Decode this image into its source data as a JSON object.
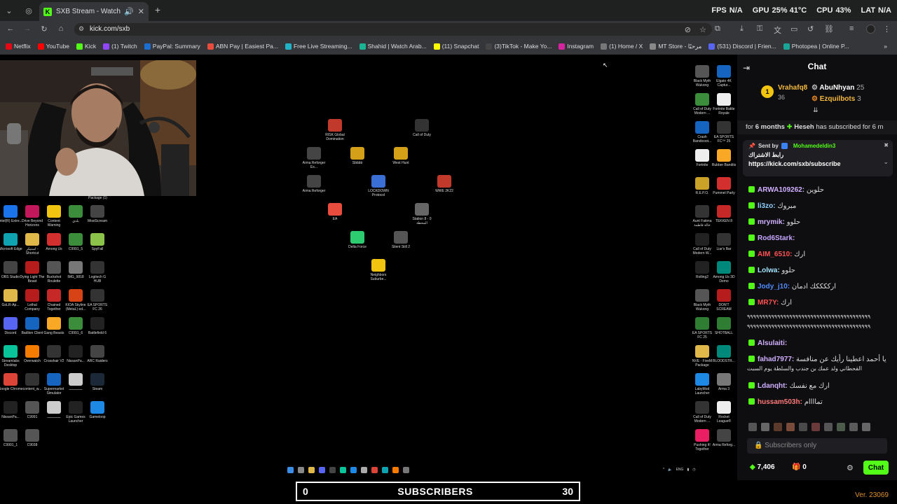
{
  "browser": {
    "tab_title": "SXB Stream - Watch Live on",
    "url": "kick.com/sxb",
    "stats": {
      "fps_label": "FPS",
      "fps_value": "N/A",
      "gpu_label": "GPU",
      "gpu_value": "25% 41°C",
      "cpu_label": "CPU",
      "cpu_value": "43%",
      "lat_label": "LAT",
      "lat_value": "N/A"
    },
    "bookmarks": [
      {
        "label": "Netflix",
        "color": "#e50914"
      },
      {
        "label": "YouTube",
        "color": "#ff0000"
      },
      {
        "label": "Kick",
        "color": "#53fc18"
      },
      {
        "label": "(1) Twitch",
        "color": "#9146ff"
      },
      {
        "label": "PayPal: Summary",
        "color": "#1a6fd1"
      },
      {
        "label": "ABN Pay | Easiest Pa...",
        "color": "#e74c3c"
      },
      {
        "label": "Free Live Streaming...",
        "color": "#21b3c6"
      },
      {
        "label": "Shahid | Watch Arab...",
        "color": "#1ab394"
      },
      {
        "label": "(11) Snapchat",
        "color": "#fffc00"
      },
      {
        "label": "(3)TikTok - Make Yo...",
        "color": "#444444"
      },
      {
        "label": "Instagram",
        "color": "#d6249f"
      },
      {
        "label": "(1) Home / X",
        "color": "#777777"
      },
      {
        "label": "MT Store - مرحبًا",
        "color": "#888888"
      },
      {
        "label": "(531) Discord | Frien...",
        "color": "#5865f2"
      },
      {
        "label": "Photopea | Online P...",
        "color": "#18a497"
      }
    ]
  },
  "desktop": {
    "webcam_caption": "Package (1)",
    "icons": [
      {
        "label": "RISK Global Domination",
        "color": "#c0392b"
      },
      {
        "label": "Call of Duty",
        "color": "#333333"
      },
      {
        "label": "Arma Reforger Ex...",
        "color": "#444444"
      },
      {
        "label": "Sbbbb",
        "color": "#d4a017"
      },
      {
        "label": "West Hunt",
        "color": "#d4a017"
      },
      {
        "label": "Arma Reforger",
        "color": "#444444"
      },
      {
        "label": "LOCKDOWN Protocol",
        "color": "#3a6fd6"
      },
      {
        "label": "WWE 2K22",
        "color": "#c0392b"
      },
      {
        "label": "EA",
        "color": "#e74c3c"
      },
      {
        "label": "Station 8 - 0 المحطة",
        "color": "#666666"
      },
      {
        "label": "Delta Force",
        "color": "#2ecc71"
      },
      {
        "label": "Silent Still 2",
        "color": "#555555"
      },
      {
        "label": "Neighbors Suburbe...",
        "color": "#f1c40f"
      }
    ],
    "left_icons": [
      {
        "label": "Intel(R) Extre...",
        "color": "#1a73e8"
      },
      {
        "label": "Drive Beyond Horizons",
        "color": "#c2185b"
      },
      {
        "label": "Content Warning",
        "color": "#f1c40f"
      },
      {
        "label": "بلدي",
        "color": "#3b8c3b"
      },
      {
        "label": "MostScream",
        "color": "#444444"
      },
      {
        "label": "Microsoft Edge",
        "color": "#0fa3b1"
      },
      {
        "label": "استیکر - Shortcut",
        "color": "#e0b84a"
      },
      {
        "label": "Among Us",
        "color": "#d32f2f"
      },
      {
        "label": "C9991_5",
        "color": "#3b8c3b"
      },
      {
        "label": "SpyFall",
        "color": "#8bc34a"
      },
      {
        "label": "OBS Studio",
        "color": "#444444"
      },
      {
        "label": "Dying Light The Beast",
        "color": "#b71c1c"
      },
      {
        "label": "Buckshot Roulette",
        "color": "#555555"
      },
      {
        "label": "IMG_9818",
        "color": "#777777"
      },
      {
        "label": "Logitech G HUB",
        "color": "#333333"
      },
      {
        "label": "GoLR-Ap...",
        "color": "#e0b84a"
      },
      {
        "label": "Lethal Company",
        "color": "#b71c1c"
      },
      {
        "label": "Chained Together",
        "color": "#c62828"
      },
      {
        "label": "KIOA Skyline (MetaL) ed...",
        "color": "#d84315"
      },
      {
        "label": "EA SPORTS FC 26",
        "color": "#333333"
      },
      {
        "label": "Discord",
        "color": "#5865f2"
      },
      {
        "label": "Badlion Client",
        "color": "#1565c0"
      },
      {
        "label": "Gang Beasts",
        "color": "#f9a825"
      },
      {
        "label": "C9991_6",
        "color": "#3b8c3b"
      },
      {
        "label": "Battlefield 6",
        "color": "#222222"
      },
      {
        "label": "Streamlabs Desktop",
        "color": "#09c39b"
      },
      {
        "label": "Overwatch",
        "color": "#f57c00"
      },
      {
        "label": "Crosshair V2",
        "color": "#333333"
      },
      {
        "label": "NissanPa...",
        "color": "#222222"
      },
      {
        "label": "ARC Raiders",
        "color": "#444444"
      },
      {
        "label": "Google Chrome",
        "color": "#db4437"
      },
      {
        "label": "content_w...",
        "color": "#333333"
      },
      {
        "label": "Supermarket Simulator",
        "color": "#1565c0"
      },
      {
        "label": "ـــــــــــــ",
        "color": "#cccccc"
      },
      {
        "label": "Steam",
        "color": "#1b2838"
      },
      {
        "label": "NissanPa...",
        "color": "#222222"
      },
      {
        "label": "C9991",
        "color": "#555555"
      },
      {
        "label": "ـــــــــــــ",
        "color": "#cccccc"
      },
      {
        "label": "Epic Games Launcher",
        "color": "#222222"
      },
      {
        "label": "Gameloop",
        "color": "#1e88e5"
      },
      {
        "label": "C9991_1",
        "color": "#555555"
      },
      {
        "label": "C9038",
        "color": "#555555"
      }
    ],
    "right_icons": [
      {
        "label": "Black Myth Wukong",
        "color": "#555555"
      },
      {
        "label": "Elgato 4K Captur...",
        "color": "#1565c0"
      },
      {
        "label": "Call of Duty Modern ...",
        "color": "#3b8c3b"
      },
      {
        "label": "Fortnite Battle Royale",
        "color": "#eeeeee"
      },
      {
        "label": "Crash Bandicoot...",
        "color": "#1565c0"
      },
      {
        "label": "EA SPORTS FC™ 25",
        "color": "#333333"
      },
      {
        "label": "Fortnite",
        "color": "#eeeeee"
      },
      {
        "label": "Rubber Bandits",
        "color": "#f9a825"
      },
      {
        "label": "R.E.P.O.",
        "color": "#c9a227"
      },
      {
        "label": "Pummel Party",
        "color": "#d32f2f"
      },
      {
        "label": "Aunt Fatima خالة فاطمة",
        "color": "#333333"
      },
      {
        "label": "TEKKEN 8",
        "color": "#c62828"
      },
      {
        "label": "Call of Duty Modern W...",
        "color": "#222222"
      },
      {
        "label": "Liar's Bar",
        "color": "#333333"
      },
      {
        "label": "Rolling2",
        "color": "#222222"
      },
      {
        "label": "Among Us 3D Demo",
        "color": "#00897b"
      },
      {
        "label": "Black Myth Wukong",
        "color": "#555555"
      },
      {
        "label": "DON'T SCREAM",
        "color": "#b71c1c"
      },
      {
        "label": "EA SPORTS FC 25",
        "color": "#2e7d32"
      },
      {
        "label": "SHOTBALL",
        "color": "#2e7d32"
      },
      {
        "label": "NVE - FiveM Package",
        "color": "#e0b84a"
      },
      {
        "label": "BLOODSTR...",
        "color": "#00897b"
      },
      {
        "label": "LabyMod Launcher",
        "color": "#1e88e5"
      },
      {
        "label": "Arma 3",
        "color": "#777777"
      },
      {
        "label": "Call of Duty Modern ...",
        "color": "#333333"
      },
      {
        "label": "Rocket League®",
        "color": "#eeeeee"
      },
      {
        "label": "Pushing It! Together",
        "color": "#e91e63"
      },
      {
        "label": "Arma Reforg...",
        "color": "#444444"
      }
    ]
  },
  "chat": {
    "title": "Chat",
    "leaderboard": [
      {
        "name": "Vrahafq8",
        "count": "36"
      },
      {
        "name": "AbuNhyan",
        "count": "25"
      },
      {
        "name": "Ezquilbots",
        "count": "3"
      }
    ],
    "sub_banner": {
      "prefix": "for",
      "months": "6 months",
      "user": "Heseh",
      "text": "has subscribed for 6 m"
    },
    "pinned": {
      "sent_by": "Sent by",
      "user": "Mohamedeldin3",
      "title": "رابط الاشتراك",
      "link": "https://kick.com/sxb/subscribe"
    },
    "messages": [
      {
        "user": "ARWA109262:",
        "text": "حلوين",
        "color": "#d0b0ff"
      },
      {
        "user": "li3zo:",
        "text": "مبروك",
        "color": "#8fd0ff"
      },
      {
        "user": "mrymik:",
        "text": "حلوو",
        "color": "#d0b0ff"
      },
      {
        "user": "Rod6Stark:",
        "text": "",
        "color": "#c7a6ff"
      },
      {
        "user": "AIM_6510:",
        "text": "ارك",
        "color": "#ff5252"
      },
      {
        "user": "Lolwa:",
        "text": "حلوو",
        "color": "#a6e3ff"
      },
      {
        "user": "Jody_j10:",
        "text": "ارككككك ادمان",
        "color": "#4f8cff"
      },
      {
        "user": "MR7Y:",
        "text": "ارك",
        "color": "#ff5252"
      },
      {
        "user": "",
        "text": "٩٩٩٩٩٩٩٩٩٩٩٩٩٩٩٩٩٩٩٩٩٩٩٩٩٩٩٩٩٩٩٩٩٩٩٩٩٩٩٩٩",
        "color": "#ffffff"
      },
      {
        "user": "",
        "text": "٩٩٩٩٩٩٩٩٩٩٩٩٩٩٩٩٩٩٩٩٩٩٩٩٩٩٩٩٩٩٩٩٩٩٩٩٩٩٩٩٩",
        "color": "#ffffff"
      },
      {
        "user": "Alsulaiti:",
        "text": "",
        "color": "#d0b0ff"
      },
      {
        "user": "fahad7977:",
        "text": "يا أحمد اعطينا رأيك عن منافسة",
        "color": "#d0b0ff"
      },
      {
        "user": "",
        "text": "القحطاني ولد عمك بن جندب والسلطة يوم السبت",
        "color": "#ffffff"
      },
      {
        "user": "Ldanqht:",
        "text": "ارك مع نفسك",
        "color": "#d0b0ff"
      },
      {
        "user": "hussam503h:",
        "text": "تماااام",
        "color": "#ff7a7a"
      }
    ],
    "input_placeholder": "Subscribers only",
    "kicks": "7,406",
    "gifts": "0",
    "send_label": "Chat"
  },
  "overlay": {
    "sub_left": "0",
    "sub_label": "SUBSCRIBERS",
    "sub_right": "30",
    "version": "Ver. 23069"
  }
}
